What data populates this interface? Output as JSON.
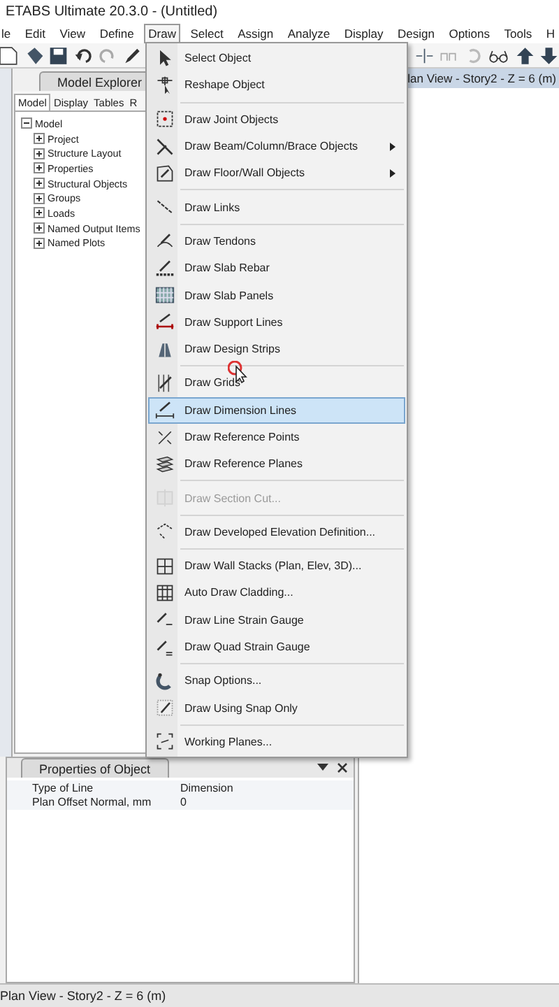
{
  "window": {
    "title": "ETABS Ultimate 20.3.0 - (Untitled)"
  },
  "menu_bar": [
    {
      "label": "le",
      "selected": false
    },
    {
      "label": "Edit",
      "selected": false
    },
    {
      "label": "View",
      "selected": false
    },
    {
      "label": "Define",
      "selected": false
    },
    {
      "label": "Draw",
      "selected": true
    },
    {
      "label": "Select",
      "selected": false
    },
    {
      "label": "Assign",
      "selected": false
    },
    {
      "label": "Analyze",
      "selected": false
    },
    {
      "label": "Display",
      "selected": false
    },
    {
      "label": "Design",
      "selected": false
    },
    {
      "label": "Options",
      "selected": false
    },
    {
      "label": "Tools",
      "selected": false
    },
    {
      "label": "H",
      "selected": false
    }
  ],
  "model_explorer": {
    "title": "Model Explorer",
    "tabs": [
      {
        "label": "Model",
        "selected": true
      },
      {
        "label": "Display",
        "selected": false
      },
      {
        "label": "Tables",
        "selected": false
      },
      {
        "label": "R",
        "selected": false
      }
    ],
    "tree": [
      {
        "label": "Model",
        "expanded": true,
        "children": [
          {
            "label": "Project",
            "expanded": false
          },
          {
            "label": "Structure Layout",
            "expanded": false
          },
          {
            "label": "Properties",
            "expanded": false
          },
          {
            "label": "Structural Objects",
            "expanded": false
          },
          {
            "label": "Groups",
            "expanded": false
          },
          {
            "label": "Loads",
            "expanded": false
          },
          {
            "label": "Named Output Items",
            "expanded": false
          },
          {
            "label": "Named Plots",
            "expanded": false
          }
        ]
      }
    ]
  },
  "view_tab": {
    "title": "lan View - Story2 - Z = 6 (m)"
  },
  "draw_menu": [
    {
      "kind": "item",
      "label": "Select Object",
      "selected": false,
      "disabled": false,
      "submenu": false
    },
    {
      "kind": "item",
      "label": "Reshape Object",
      "selected": false,
      "disabled": false,
      "submenu": false
    },
    {
      "kind": "separator"
    },
    {
      "kind": "item",
      "label": "Draw Joint Objects",
      "selected": false,
      "disabled": false,
      "submenu": false
    },
    {
      "kind": "item",
      "label": "Draw Beam/Column/Brace Objects",
      "selected": false,
      "disabled": false,
      "submenu": true
    },
    {
      "kind": "item",
      "label": "Draw Floor/Wall Objects",
      "selected": false,
      "disabled": false,
      "submenu": true
    },
    {
      "kind": "separator"
    },
    {
      "kind": "item",
      "label": "Draw Links",
      "selected": false,
      "disabled": false,
      "submenu": false
    },
    {
      "kind": "separator"
    },
    {
      "kind": "item",
      "label": "Draw Tendons",
      "selected": false,
      "disabled": false,
      "submenu": false
    },
    {
      "kind": "item",
      "label": "Draw Slab Rebar",
      "selected": false,
      "disabled": false,
      "submenu": false
    },
    {
      "kind": "item",
      "label": "Draw Slab Panels",
      "selected": false,
      "disabled": false,
      "submenu": false
    },
    {
      "kind": "item",
      "label": "Draw Support Lines",
      "selected": false,
      "disabled": false,
      "submenu": false
    },
    {
      "kind": "item",
      "label": "Draw Design Strips",
      "selected": false,
      "disabled": false,
      "submenu": false
    },
    {
      "kind": "separator"
    },
    {
      "kind": "item",
      "label": "Draw Grids",
      "selected": false,
      "disabled": false,
      "submenu": false
    },
    {
      "kind": "item",
      "label": "Draw Dimension Lines",
      "selected": true,
      "disabled": false,
      "submenu": false
    },
    {
      "kind": "item",
      "label": "Draw Reference Points",
      "selected": false,
      "disabled": false,
      "submenu": false
    },
    {
      "kind": "item",
      "label": "Draw Reference Planes",
      "selected": false,
      "disabled": false,
      "submenu": false
    },
    {
      "kind": "separator"
    },
    {
      "kind": "item",
      "label": "Draw Section Cut...",
      "selected": false,
      "disabled": true,
      "submenu": false
    },
    {
      "kind": "separator"
    },
    {
      "kind": "item",
      "label": "Draw Developed Elevation Definition...",
      "selected": false,
      "disabled": false,
      "submenu": false
    },
    {
      "kind": "separator"
    },
    {
      "kind": "item",
      "label": "Draw Wall Stacks (Plan, Elev, 3D)...",
      "selected": false,
      "disabled": false,
      "submenu": false
    },
    {
      "kind": "item",
      "label": "Auto Draw Cladding...",
      "selected": false,
      "disabled": false,
      "submenu": false
    },
    {
      "kind": "item",
      "label": "Draw Line Strain Gauge",
      "selected": false,
      "disabled": false,
      "submenu": false
    },
    {
      "kind": "item",
      "label": "Draw Quad Strain Gauge",
      "selected": false,
      "disabled": false,
      "submenu": false
    },
    {
      "kind": "separator"
    },
    {
      "kind": "item",
      "label": "Snap Options...",
      "selected": false,
      "disabled": false,
      "submenu": false
    },
    {
      "kind": "item",
      "label": "Draw Using Snap Only",
      "selected": false,
      "disabled": false,
      "submenu": false
    },
    {
      "kind": "separator"
    },
    {
      "kind": "item",
      "label": "Working Planes...",
      "selected": false,
      "disabled": false,
      "submenu": false
    }
  ],
  "properties": {
    "title": "Properties of Object",
    "rows": [
      {
        "name": "Type of Line",
        "value": "Dimension"
      },
      {
        "name": "Plan Offset Normal, mm",
        "value": "0"
      }
    ]
  },
  "status_bar": {
    "text": "Plan View - Story2 - Z = 6 (m)"
  }
}
